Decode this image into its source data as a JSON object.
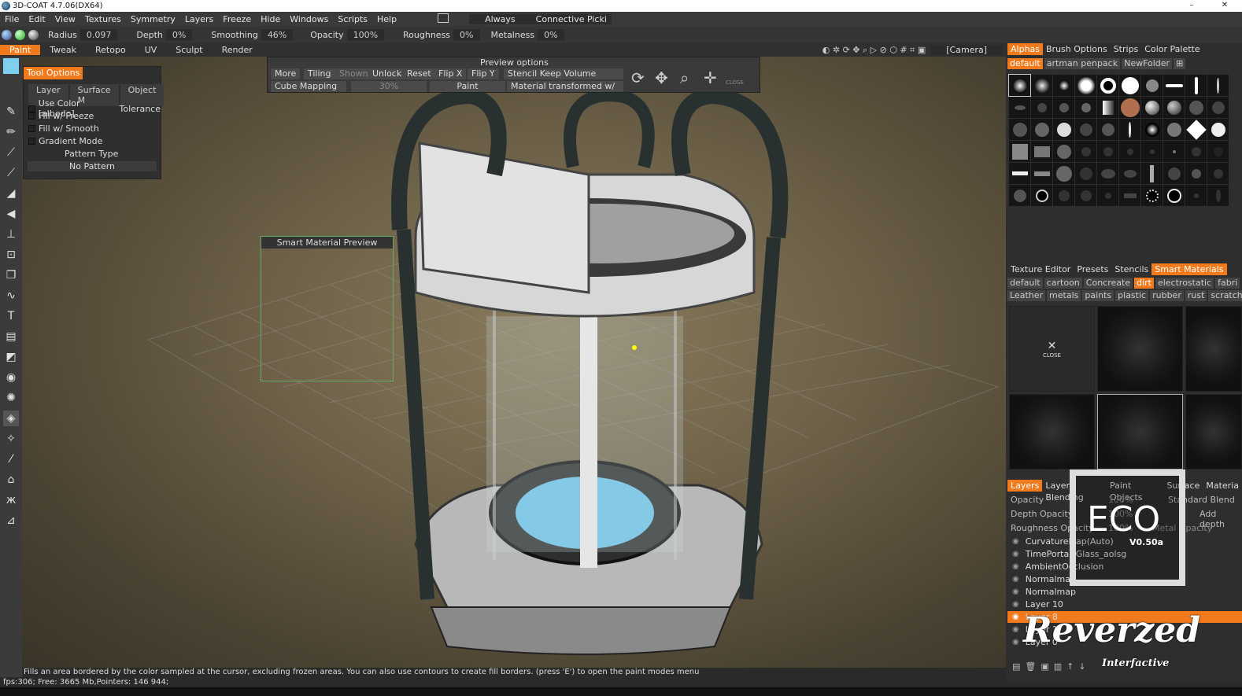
{
  "window": {
    "title": "3D-COAT 4.7.06(DX64)",
    "minimize": "–",
    "close": "✕"
  },
  "menu": [
    "File",
    "Edit",
    "View",
    "Textures",
    "Symmetry",
    "Layers",
    "Freeze",
    "Hide",
    "Windows",
    "Scripts",
    "Help"
  ],
  "menu_extra": {
    "always": "Always",
    "connective": "Connective Picki"
  },
  "toolbar": {
    "radius_label": "Radius",
    "radius": "0.097",
    "depth_label": "Depth",
    "depth": "0%",
    "smoothing_label": "Smoothing",
    "smoothing": "46%",
    "opacity_label": "Opacity",
    "opacity": "100%",
    "roughness_label": "Roughness",
    "roughness": "0%",
    "metalness_label": "Metalness",
    "metalness": "0%"
  },
  "rooms": [
    "Paint",
    "Tweak",
    "Retopo",
    "UV",
    "Sculpt",
    "Render"
  ],
  "camera": "[Camera]",
  "tool_options": {
    "title": "Tool Options",
    "tabs": [
      "Layer",
      "Surface M",
      "Object"
    ],
    "use_color": "Use Color [albedo]",
    "tolerance": "Tolerance",
    "fill_freeze": "Fill w/ Freeze",
    "fill_smooth": "Fill w/ Smooth",
    "gradient": "Gradient Mode",
    "pattern_type": "Pattern Type",
    "pattern": "No Pattern"
  },
  "preview": {
    "title": "Preview options",
    "more": "More",
    "tiling": "Tiling",
    "shown": "Shown",
    "unlock": "Unlock",
    "reset": "Reset",
    "flipx": "Flip X",
    "flipy": "Flip Y",
    "stencil": "Stencil Keep Volume",
    "mapping": "Cube Mapping",
    "percent": "30%",
    "paint": "Paint",
    "mat": "Material transformed w/",
    "close": "CLOSE"
  },
  "smart_preview": "Smart Material Preview",
  "status": "Fills an area bordered by the color sampled at the cursor, excluding frozen areas. You can also use contours to create fill borders. (press 'E') to open the paint modes menu",
  "fps": "fps:306;   Free: 3665 Mb,Pointers: 146 944;",
  "right": {
    "tabs1": [
      "Alphas",
      "Brush Options",
      "Strips",
      "Color Palette"
    ],
    "folders1": [
      "default",
      "artman penpack",
      "NewFolder"
    ],
    "tabs2": [
      "Texture Editor",
      "Presets",
      "Stencils",
      "Smart Materials"
    ],
    "folders2a": [
      "default",
      "cartoon",
      "Concreate",
      "dirt",
      "electrostatic",
      "fabri"
    ],
    "folders2b": [
      "Leather",
      "metals",
      "paints",
      "plastic",
      "rubber",
      "rust",
      "scratches"
    ],
    "close": "CLOSE",
    "tabs3": [
      "Layers",
      "Layer Blending",
      "Paint Objects",
      "Surface",
      "Materia"
    ],
    "props": {
      "opacity": "Opacity",
      "opacity_v": "100%",
      "blend": "Standard Blend",
      "depth": "Depth Opacity",
      "depth_v": "100%",
      "add_depth": "Add depth",
      "rough": "Roughness Opacity",
      "rough_v": "100%",
      "metal": "Metal Opacity"
    },
    "layers": [
      "CurvatureMap(Auto)",
      "TimePortal_Glass_aolsg",
      "AmbientOcclusion",
      "Normalmap",
      "Normalmap",
      "Layer 10",
      "Layer 8",
      "Layer 1",
      "Layer 0"
    ]
  },
  "watermark": {
    "eco": "ECO",
    "ver": "V0.50a",
    "brand": "Reverzed",
    "sub": "Interfactive"
  },
  "colors": {
    "accent": "#f07a1c",
    "swatch": "#7fd0ef"
  }
}
